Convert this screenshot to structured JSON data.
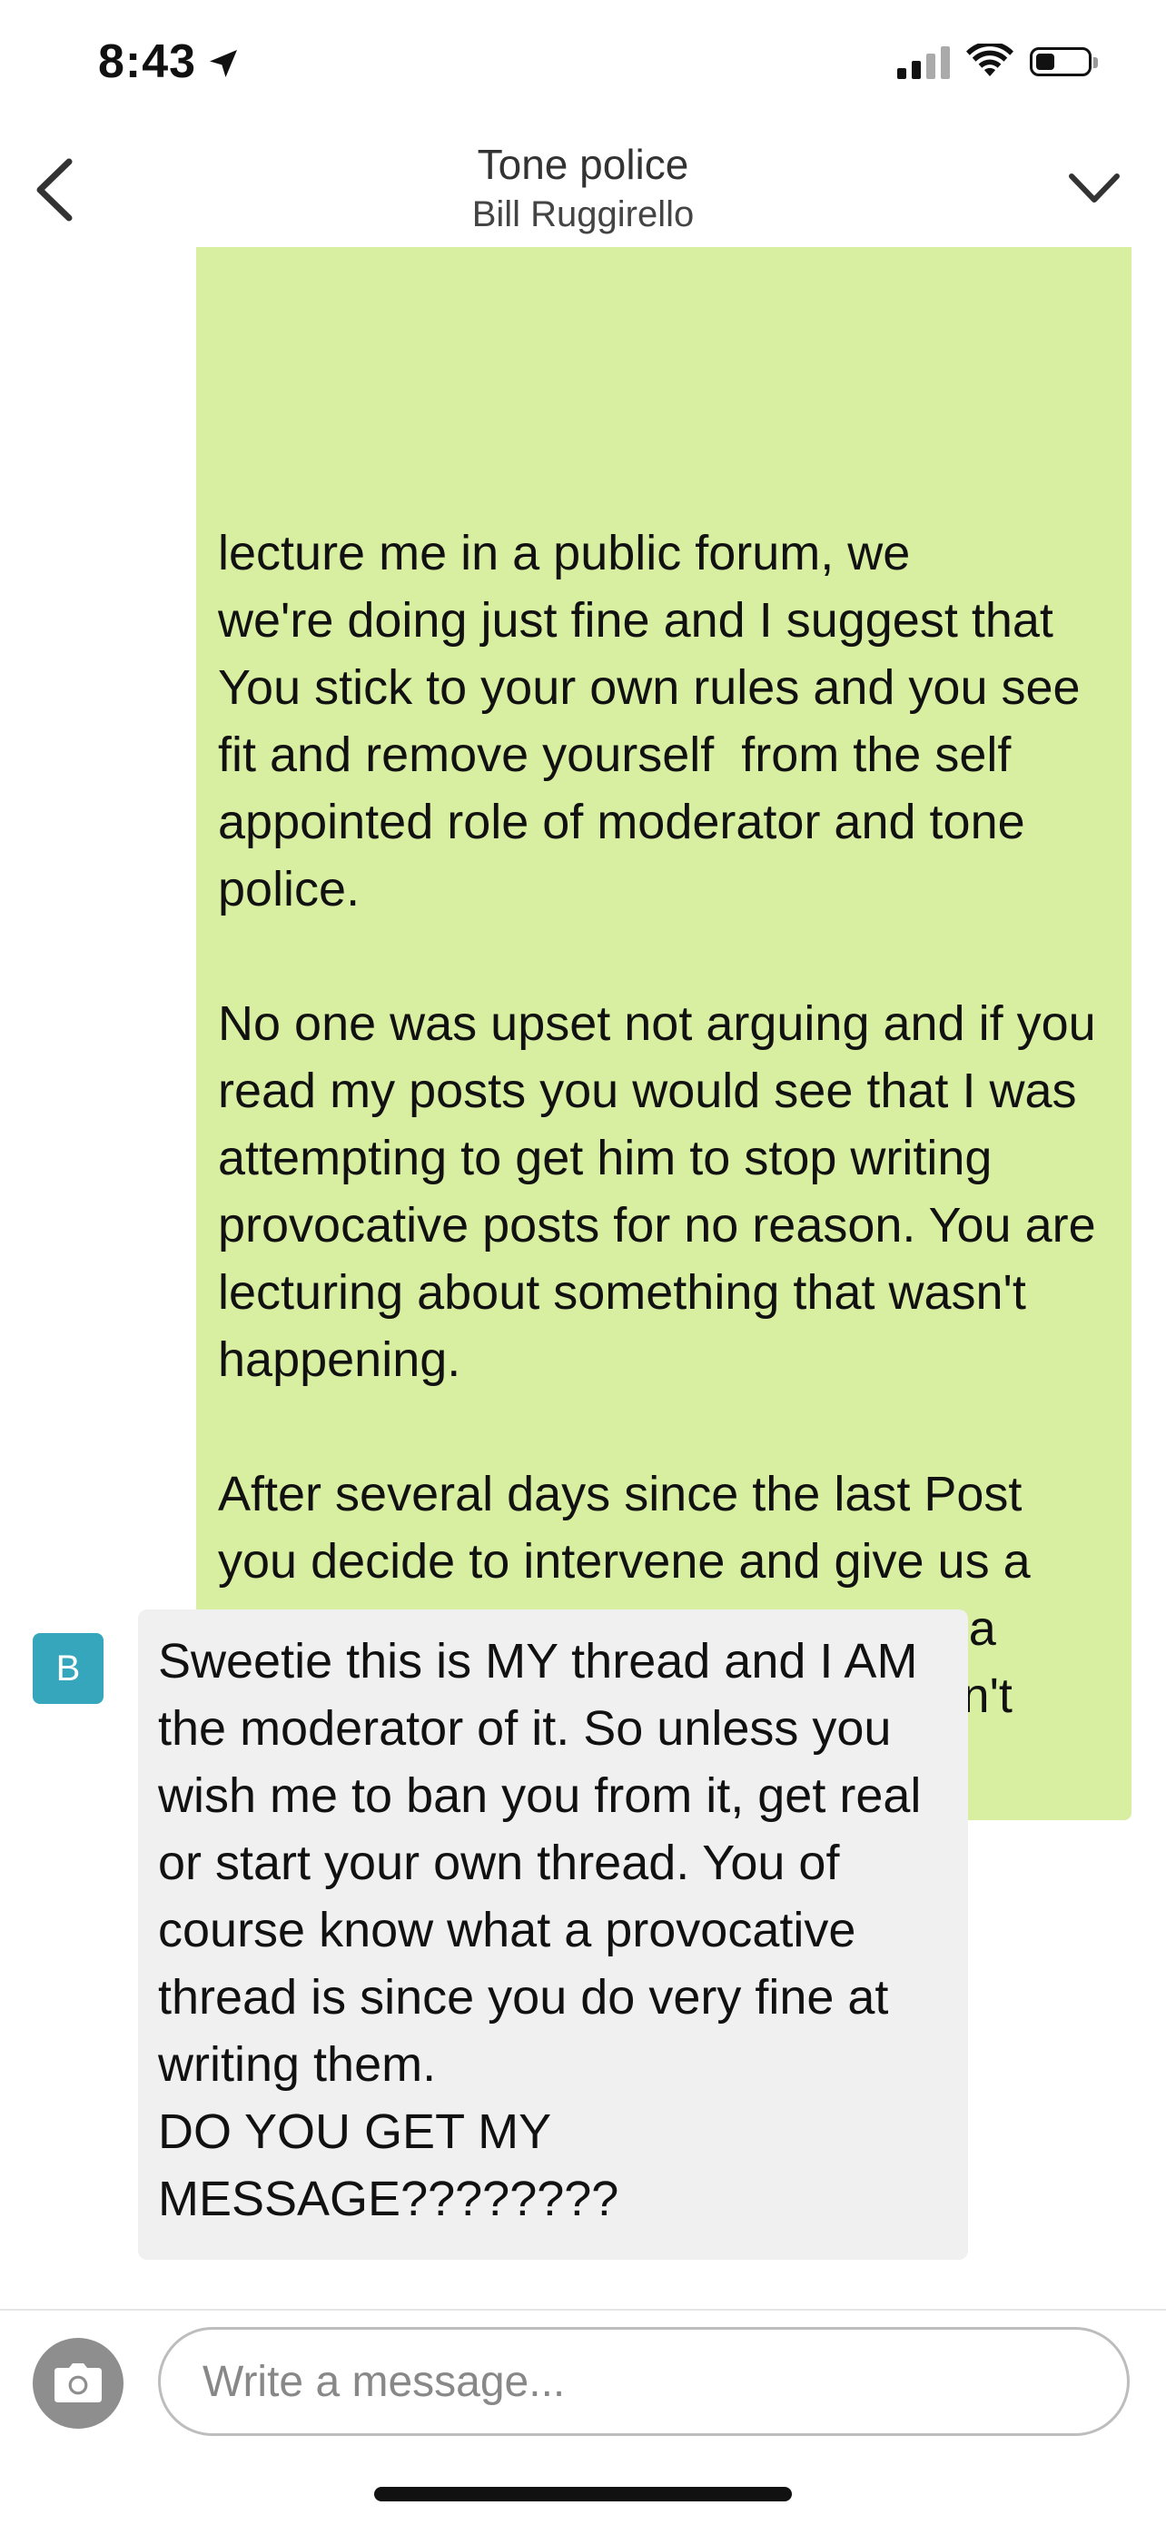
{
  "status_bar": {
    "time": "8:43",
    "icons": [
      "location-arrow-icon",
      "signal-icon",
      "wifi-icon",
      "battery-icon"
    ],
    "battery_level": 0.35
  },
  "header": {
    "title": "Tone police",
    "subtitle": "Bill Ruggirello",
    "back_icon": "chevron-left-icon",
    "menu_icon": "chevron-down-icon"
  },
  "messages": [
    {
      "type": "sent",
      "color": "#d8eea0",
      "text": "lecture me in a public forum, we\nwe're doing just fine and I suggest that\nYou stick to your own rules and you see fit and remove yourself  from the self appointed role of moderator and tone police.\n\nNo one was upset not arguing and if you read my posts you would see that I was attempting to get him to stop writing provocative posts for no reason. You are lecturing about something that wasn't happening.\n\nAfter several days since the last Post you decide to intervene and give us a lecture in evaluating evidence. I'm a doctor and a grown up - please don't lecture me again."
    },
    {
      "type": "received",
      "avatar_letter": "B",
      "avatar_color": "#36a6bc",
      "color": "#f0f0f0",
      "text": "Sweetie this is MY thread and I AM the moderator of it. So unless you wish me to ban you from it, get real or start your own thread. You of course know what a provocative thread is since you do very fine at writing them.\nDO YOU GET MY MESSAGE????????"
    }
  ],
  "compose": {
    "placeholder": "Write a message...",
    "value": "",
    "camera_icon": "camera-icon"
  }
}
